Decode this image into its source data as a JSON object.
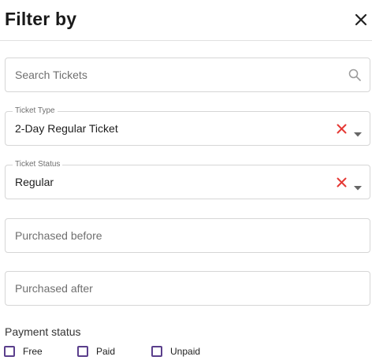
{
  "header": {
    "title": "Filter by",
    "close_icon": "close-icon"
  },
  "search": {
    "placeholder": "Search Tickets",
    "icon": "search-icon"
  },
  "ticket_type": {
    "label": "Ticket Type",
    "value": "2-Day Regular Ticket"
  },
  "ticket_status": {
    "label": "Ticket Status",
    "value": "Regular"
  },
  "purchased_before": {
    "placeholder": "Purchased before"
  },
  "purchased_after": {
    "placeholder": "Purchased after"
  },
  "payment_status": {
    "label": "Payment status",
    "options": [
      {
        "label": "Free",
        "checked": false
      },
      {
        "label": "Paid",
        "checked": false
      },
      {
        "label": "Unpaid",
        "checked": false
      }
    ]
  },
  "colors": {
    "clear": "#e53935",
    "checkbox_border": "#5b3f8c",
    "field_border": "#d6d6d6"
  }
}
